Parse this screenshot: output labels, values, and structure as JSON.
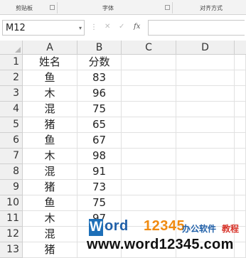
{
  "ribbon": {
    "groups": [
      "剪贴板",
      "字体",
      "对齐方式"
    ]
  },
  "formula_bar": {
    "name_box": "M12",
    "name_box_dropdown": "▾",
    "separator": "⋮",
    "cancel_icon": "✕",
    "enter_icon": "✓",
    "function_icon": "fx",
    "formula_value": ""
  },
  "sheet": {
    "columns": [
      "A",
      "B",
      "C",
      "D"
    ],
    "rows": [
      {
        "num": "1",
        "A": "姓名",
        "B": "分数"
      },
      {
        "num": "2",
        "A": "鱼",
        "B": "83"
      },
      {
        "num": "3",
        "A": "木",
        "B": "96"
      },
      {
        "num": "4",
        "A": "混",
        "B": "75"
      },
      {
        "num": "5",
        "A": "猪",
        "B": "65"
      },
      {
        "num": "6",
        "A": "鱼",
        "B": "67"
      },
      {
        "num": "7",
        "A": "木",
        "B": "98"
      },
      {
        "num": "8",
        "A": "混",
        "B": "91"
      },
      {
        "num": "9",
        "A": "猪",
        "B": "73"
      },
      {
        "num": "10",
        "A": "鱼",
        "B": "75"
      },
      {
        "num": "11",
        "A": "木",
        "B": "97"
      },
      {
        "num": "12",
        "A": "混",
        "B": ""
      },
      {
        "num": "13",
        "A": "猪",
        "B": ""
      }
    ]
  },
  "watermark": {
    "logo_letter": "W",
    "brand_part1": "ord",
    "brand_part2": "12345",
    "tagline_part1": "办公软件",
    "tagline_part2": "教程",
    "url": "www.word12345.com"
  },
  "colors": {
    "header_bg": "#f0f0f0",
    "gridline": "#e1e1e1",
    "brand_blue": "#1f5fa8",
    "brand_orange": "#f08a10"
  }
}
